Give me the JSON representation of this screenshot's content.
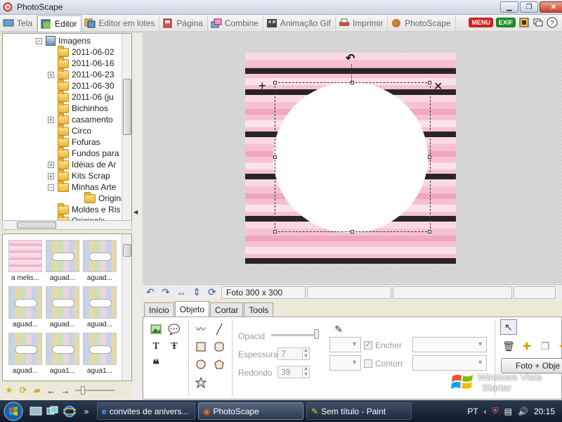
{
  "window": {
    "title": "PhotoScape"
  },
  "tabs": [
    {
      "label": "Tela",
      "icon": "monitor-icon",
      "active": false
    },
    {
      "label": "Editor",
      "icon": "editor-icon",
      "active": true
    },
    {
      "label": "Editor em lotes",
      "icon": "batch-editor-icon",
      "active": false
    },
    {
      "label": "Página",
      "icon": "page-icon",
      "active": false
    },
    {
      "label": "Combine",
      "icon": "combine-icon",
      "active": false
    },
    {
      "label": "Animação Gif",
      "icon": "gif-icon",
      "active": false
    },
    {
      "label": "Imprimir",
      "icon": "print-icon",
      "active": false
    },
    {
      "label": "PhotoScape",
      "icon": "photoscape-icon",
      "active": false
    }
  ],
  "toolbar_right": {
    "menu_label": "MENU",
    "exif_label": "EXIF"
  },
  "tree": {
    "root": "Imagens",
    "items": [
      {
        "label": "2011-06-02",
        "expander": ""
      },
      {
        "label": "2011-06-16",
        "expander": ""
      },
      {
        "label": "2011-06-23",
        "expander": "+"
      },
      {
        "label": "2011-06-30",
        "expander": ""
      },
      {
        "label": "2011-06 (ju",
        "expander": ""
      },
      {
        "label": "Bichinhos",
        "expander": ""
      },
      {
        "label": "casamento",
        "expander": "+"
      },
      {
        "label": "Circo",
        "expander": ""
      },
      {
        "label": "Fofuras",
        "expander": ""
      },
      {
        "label": "Fundos para",
        "expander": ""
      },
      {
        "label": "Idéias de Ar",
        "expander": "+"
      },
      {
        "label": "Kits Scrap",
        "expander": "+"
      },
      {
        "label": "Minhas Arte",
        "expander": "−"
      },
      {
        "label": "Originals",
        "expander": "",
        "child": true
      },
      {
        "label": "Moldes e Ris",
        "expander": ""
      },
      {
        "label": "Originals",
        "expander": ""
      }
    ]
  },
  "thumbnails": [
    {
      "caption": "a melis...",
      "style": "pink"
    },
    {
      "caption": "aguad...",
      "style": "pastel"
    },
    {
      "caption": "aguad...",
      "style": "pastel"
    },
    {
      "caption": "aguad...",
      "style": "pastel"
    },
    {
      "caption": "aguad...",
      "style": "pastel"
    },
    {
      "caption": "aguad...",
      "style": "pastel"
    },
    {
      "caption": "aguad...",
      "style": "pastel"
    },
    {
      "caption": "agua1...",
      "style": "pastel"
    },
    {
      "caption": "agua1...",
      "style": "pastel"
    }
  ],
  "status": {
    "photo_size": "Foto 300 x 300"
  },
  "object_tabs": [
    {
      "label": "Início",
      "active": false
    },
    {
      "label": "Objeto",
      "active": true
    },
    {
      "label": "Cortar",
      "active": false
    },
    {
      "label": "Tools",
      "active": false
    }
  ],
  "object_panel": {
    "opacity_label": "Opacid",
    "opacity_percent": 100,
    "thickness_label": "Espessura",
    "thickness_value": "7",
    "rounding_label": "Redondo",
    "rounding_value": "39",
    "fill_label": "Encher",
    "fill_checked": true,
    "outline_label": "Contorr",
    "outline_checked": false,
    "foto_button": "Foto + Obje"
  },
  "watermark": {
    "line1": "Windows Vista",
    "line2": "Starter"
  },
  "taskbar": {
    "buttons": [
      {
        "label": "convites de anivers...",
        "icon": "ie-icon"
      },
      {
        "label": "PhotoScape",
        "icon": "photoscape-icon",
        "active": true
      },
      {
        "label": "Sem título - Paint",
        "icon": "paint-icon"
      }
    ],
    "language": "PT",
    "clock": "20:15"
  },
  "colors": {
    "stripe_light": "#f9d3df",
    "stripe_mid": "#f3b5c9",
    "stripe_dark": "#2b2426",
    "accent_red": "#d42020"
  }
}
